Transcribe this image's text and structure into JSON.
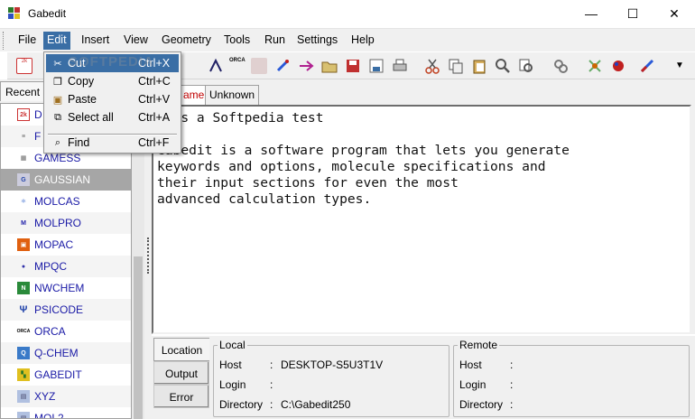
{
  "window": {
    "title": "Gabedit",
    "minimize": "—",
    "maximize": "☐",
    "close": "✕"
  },
  "menubar": [
    "File",
    "Edit",
    "Insert",
    "View",
    "Geometry",
    "Tools",
    "Run",
    "Settings",
    "Help"
  ],
  "active_menu": "Edit",
  "edit_menu": {
    "items": [
      {
        "label": "Cut",
        "accel": "Ctrl+X",
        "icon": "scissors-icon"
      },
      {
        "label": "Copy",
        "accel": "Ctrl+C",
        "icon": "copy-icon"
      },
      {
        "label": "Paste",
        "accel": "Ctrl+V",
        "icon": "paste-icon"
      },
      {
        "label": "Select all",
        "accel": "Ctrl+A",
        "icon": "select-all-icon"
      },
      {
        "label": "Find",
        "accel": "Ctrl+F",
        "icon": "find-icon"
      }
    ],
    "highlighted": "Cut"
  },
  "left_panel": {
    "tab": "Recent",
    "programs": [
      {
        "name": "DALTON",
        "visible_label": "D",
        "icon": "dalton-icon"
      },
      {
        "name": "FIREFLY",
        "visible_label": "F",
        "icon": "firefly-icon"
      },
      {
        "name": "GAMESS",
        "visible_label": "GAMESS",
        "icon": "gamess-icon"
      },
      {
        "name": "GAUSSIAN",
        "visible_label": "GAUSSIAN",
        "icon": "gaussian-icon",
        "selected": true
      },
      {
        "name": "MOLCAS",
        "visible_label": "MOLCAS",
        "icon": "molcas-icon"
      },
      {
        "name": "MOLPRO",
        "visible_label": "MOLPRO",
        "icon": "molpro-icon"
      },
      {
        "name": "MOPAC",
        "visible_label": "MOPAC",
        "icon": "mopac-icon"
      },
      {
        "name": "MPQC",
        "visible_label": "MPQC",
        "icon": "mpqc-icon"
      },
      {
        "name": "NWCHEM",
        "visible_label": "NWCHEM",
        "icon": "nwchem-icon"
      },
      {
        "name": "PSICODE",
        "visible_label": "PSICODE",
        "icon": "psicode-icon"
      },
      {
        "name": "ORCA",
        "visible_label": "ORCA",
        "icon": "orca-icon"
      },
      {
        "name": "Q-CHEM",
        "visible_label": "Q-CHEM",
        "icon": "qchem-icon"
      },
      {
        "name": "GABEDIT",
        "visible_label": "GABEDIT",
        "icon": "gabedit-icon"
      },
      {
        "name": "XYZ",
        "visible_label": "XYZ",
        "icon": "xyz-icon"
      },
      {
        "name": "MOL2",
        "visible_label": "MOL2",
        "icon": "mol2-icon"
      }
    ]
  },
  "editor": {
    "tabs": [
      "ame",
      "Unknown"
    ],
    "text": "s is a Softpedia test\n\nGabedit is a software program that lets you generate\nkeywords and options, molecule specifications and\ntheir input sections for even the most\nadvanced calculation types."
  },
  "bottom": {
    "tabs": [
      "Location",
      "Output",
      "Error"
    ],
    "local": {
      "title": "Local",
      "host_label": "Host",
      "host": "DESKTOP-S5U3T1V",
      "login_label": "Login",
      "login": "",
      "directory_label": "Directory",
      "directory": "C:\\Gabedit250"
    },
    "remote": {
      "title": "Remote",
      "host_label": "Host",
      "host": "",
      "login_label": "Login",
      "login": "",
      "directory_label": "Directory",
      "directory": ""
    }
  },
  "watermark": "SOFTPEDIA"
}
